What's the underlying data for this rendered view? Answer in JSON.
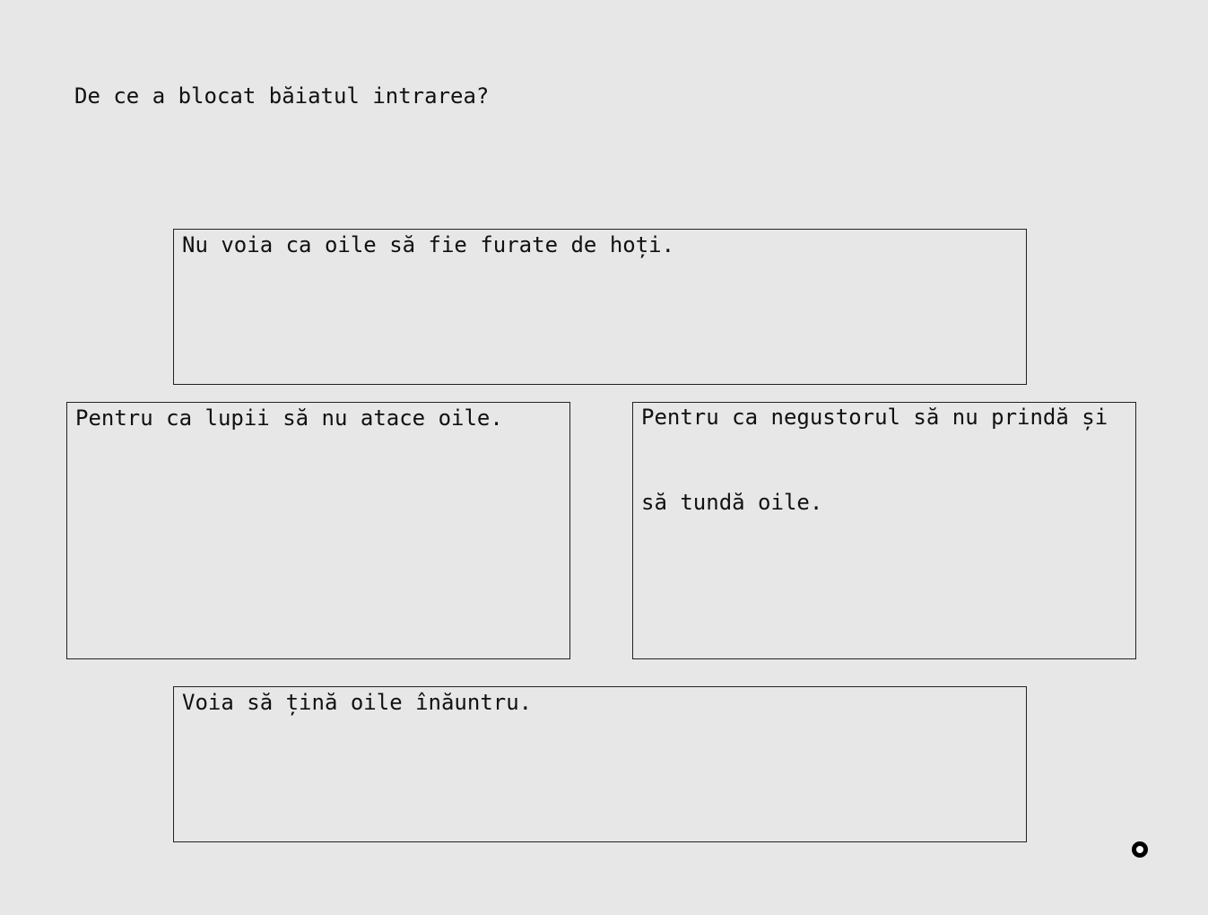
{
  "question": {
    "text": "De ce a blocat băiatul intrarea?"
  },
  "answers": [
    {
      "text": "Nu voia ca oile să fie furate de hoți."
    },
    {
      "text": "Pentru ca lupii să nu atace oile."
    },
    {
      "text": "Pentru ca negustorul să nu prindă și\nsă tundă oile."
    },
    {
      "text": "Voia să țină oile înăuntru."
    }
  ],
  "indicator": {
    "icon": "record-icon"
  }
}
